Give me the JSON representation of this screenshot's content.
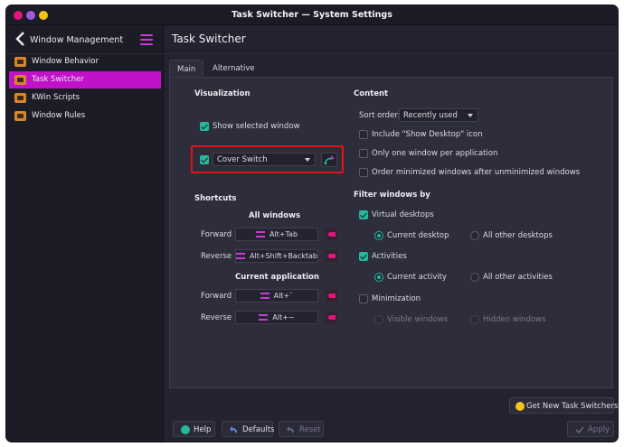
{
  "window": {
    "title": "Task Switcher — System Settings"
  },
  "sidebar": {
    "header": "Window Management",
    "items": [
      {
        "label": "Window Behavior"
      },
      {
        "label": "Task Switcher"
      },
      {
        "label": "KWin Scripts"
      },
      {
        "label": "Window Rules"
      }
    ]
  },
  "main": {
    "title": "Task Switcher",
    "tabs": [
      {
        "label": "Main"
      },
      {
        "label": "Alternative"
      }
    ]
  },
  "visualization": {
    "heading": "Visualization",
    "show_selected_window": "Show selected window",
    "switcher_value": "Cover Switch"
  },
  "shortcuts": {
    "heading": "Shortcuts",
    "all_windows": "All windows",
    "current_application": "Current application",
    "forward": "Forward",
    "reverse": "Reverse",
    "all_forward_key": "Alt+Tab",
    "all_reverse_key": "Alt+Shift+Backtab",
    "app_forward_key": "Alt+`",
    "app_reverse_key": "Alt+~"
  },
  "content": {
    "heading": "Content",
    "sort_order_label": "Sort order:",
    "sort_order_value": "Recently used",
    "include_show_desktop": "Include \"Show Desktop\" icon",
    "only_one_window": "Only one window per application",
    "order_minimized": "Order minimized windows after unminimized windows"
  },
  "filter": {
    "heading": "Filter windows by",
    "virtual_desktops": "Virtual desktops",
    "current_desktop": "Current desktop",
    "all_other_desktops": "All other desktops",
    "activities": "Activities",
    "current_activity": "Current activity",
    "all_other_activities": "All other activities",
    "minimization": "Minimization",
    "visible_windows": "Visible windows",
    "hidden_windows": "Hidden windows"
  },
  "buttons": {
    "get_new": "Get New Task Switchers...",
    "help": "Help",
    "defaults": "Defaults",
    "reset": "Reset",
    "apply": "Apply"
  },
  "colors": {
    "accent": "#c112c9",
    "check": "#28b79c",
    "highlight_box": "#e2121c"
  }
}
